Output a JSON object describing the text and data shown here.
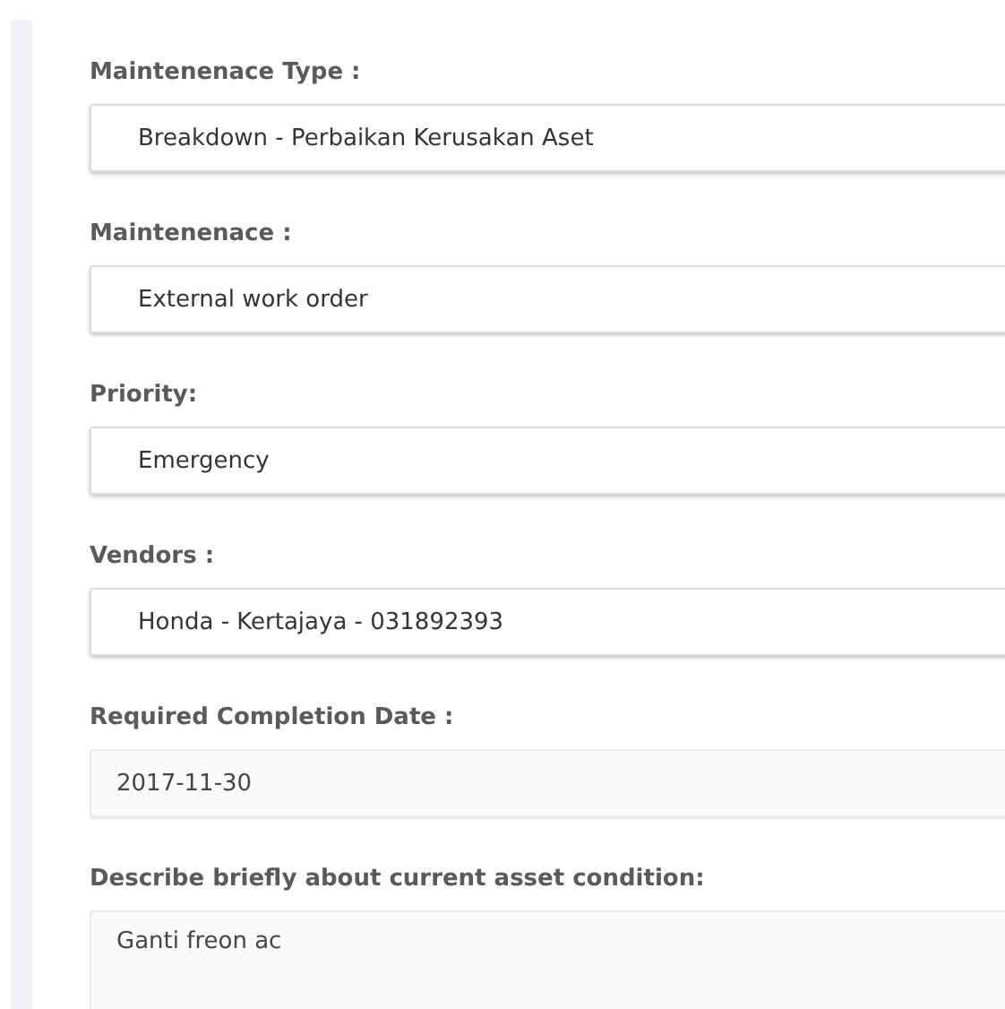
{
  "fields": [
    {
      "label": "Maintenenace Type :",
      "kind": "select",
      "value": "Breakdown - Perbaikan Kerusakan Aset"
    },
    {
      "label": "Maintenenace :",
      "kind": "select",
      "value": "External work order"
    },
    {
      "label": "Priority:",
      "kind": "select",
      "value": "Emergency"
    },
    {
      "label": "Vendors :",
      "kind": "select",
      "value": "Honda - Kertajaya - 031892393"
    },
    {
      "label": "Required Completion Date :",
      "kind": "date",
      "value": "2017-11-30"
    },
    {
      "label": "Describe briefly about current asset condition:",
      "kind": "textarea",
      "value": "Ganti freon ac"
    }
  ]
}
